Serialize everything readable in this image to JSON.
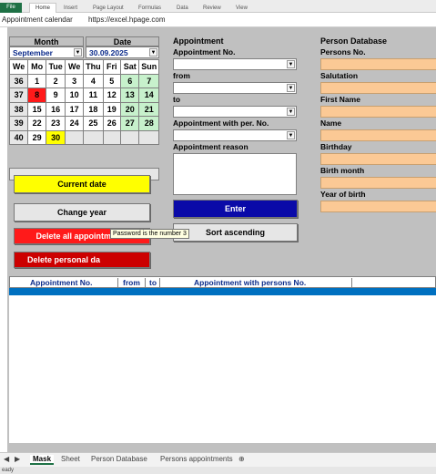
{
  "ribbon": {
    "tabs": [
      "File",
      "Home",
      "Insert",
      "Page Layout",
      "Formulas",
      "Data",
      "Review",
      "View"
    ]
  },
  "titlebar": {
    "sheet_title": "Appointment calendar",
    "url": "https://excel.hpage.com"
  },
  "calendar": {
    "month_header": "Month",
    "date_header": "Date",
    "month_value": "September",
    "date_value": "30.09.2025",
    "weekday_headers": [
      "We",
      "Mo",
      "Tue",
      "We",
      "Thu",
      "Fri",
      "Sat",
      "Sun"
    ],
    "rows": [
      [
        "36",
        "1",
        "2",
        "3",
        "4",
        "5",
        "6",
        "7"
      ],
      [
        "37",
        "8",
        "9",
        "10",
        "11",
        "12",
        "13",
        "14"
      ],
      [
        "38",
        "15",
        "16",
        "17",
        "18",
        "19",
        "20",
        "21"
      ],
      [
        "39",
        "22",
        "23",
        "24",
        "25",
        "26",
        "27",
        "28"
      ],
      [
        "40",
        "29",
        "30",
        "",
        "",
        "",
        "",
        ""
      ]
    ],
    "today": "8",
    "selected": "30"
  },
  "buttons": {
    "current_date": "Current date",
    "change_year": "Change year",
    "delete_all": "Delete all appointments",
    "delete_personal": "Delete personal da",
    "enter": "Enter",
    "sort_ascending": "Sort ascending"
  },
  "colors": {
    "yellow": "#ffff00",
    "red": "#ff1a1a",
    "blue": "#0a0aa8",
    "orange": "#fbc995",
    "green": "#c7f1cc",
    "header_blue": "#0070c0"
  },
  "appointment": {
    "header": "Appointment",
    "no_label": "Appointment No.",
    "from_label": "from",
    "to_label": "to",
    "with_label": "Appointment with per. No.",
    "reason_label": "Appointment reason"
  },
  "person_db": {
    "header": "Person Database",
    "fields": [
      "Persons No.",
      "Salutation",
      "First Name",
      "Name",
      "Birthday",
      "Birth month",
      "Year of birth"
    ]
  },
  "tooltip": "Password is the number 3",
  "results": {
    "columns": [
      "Appointment No.",
      "from",
      "to",
      "Appointment with persons No."
    ]
  },
  "sheet_tabs": [
    "Mask",
    "Sheet",
    "Person Database",
    "Persons appointments"
  ],
  "status": "eady"
}
